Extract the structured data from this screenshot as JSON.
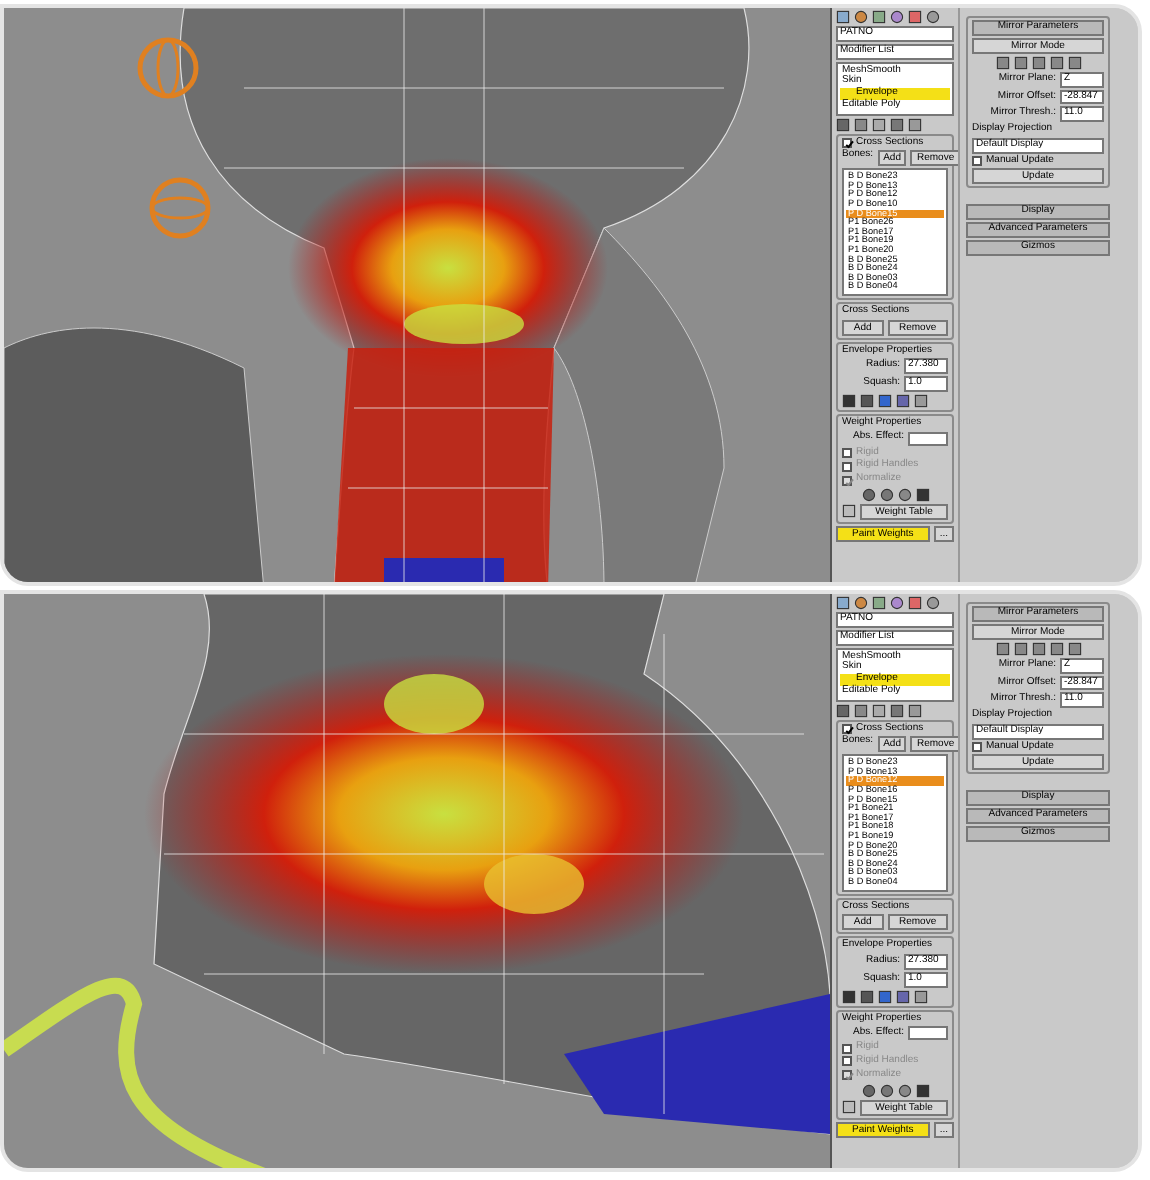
{
  "panels": [
    {
      "viewport": {
        "kind": "calf"
      },
      "modifier_name": "PATNO",
      "modifier_list": "Modifier List",
      "stack": [
        {
          "label": "MeshSmooth",
          "selected": false
        },
        {
          "label": "Skin",
          "selected": false
        },
        {
          "label": "Envelope",
          "selected": true
        },
        {
          "label": "Editable Poly",
          "selected": false
        }
      ],
      "cross_sections_check": {
        "label": "Cross Sections",
        "checked": true
      },
      "bones_label": "Bones:",
      "bone_buttons": [
        "Add",
        "Remove"
      ],
      "bones": [
        {
          "label": "B D Bone23",
          "selected": false
        },
        {
          "label": "P D Bone13",
          "selected": false
        },
        {
          "label": "P D Bone12",
          "selected": false
        },
        {
          "label": "P D Bone10",
          "selected": false
        },
        {
          "label": "P D Bone15",
          "selected": true
        },
        {
          "label": "P1 Bone26",
          "selected": false
        },
        {
          "label": "P1 Bone17",
          "selected": false
        },
        {
          "label": "P1 Bone19",
          "selected": false
        },
        {
          "label": "P1 Bone20",
          "selected": false
        },
        {
          "label": "B D Bone25",
          "selected": false
        },
        {
          "label": "B D Bone24",
          "selected": false
        },
        {
          "label": "B D Bone03",
          "selected": false
        },
        {
          "label": "B D Bone04",
          "selected": false
        }
      ],
      "cross_sections": {
        "title": "Cross Sections",
        "buttons": [
          "Add",
          "Remove"
        ]
      },
      "envelope": {
        "title": "Envelope Properties",
        "fields": [
          {
            "label": "Radius:",
            "value": "27.380"
          },
          {
            "label": "Squash:",
            "value": "1.0"
          }
        ]
      },
      "weight": {
        "title": "Weight Properties",
        "abs_effect": "Abs. Effect:",
        "checks": [
          {
            "label": "Rigid",
            "checked": false,
            "disabled": true
          },
          {
            "label": "Rigid Handles",
            "checked": false,
            "disabled": true
          },
          {
            "label": "Normalize",
            "checked": true,
            "disabled": true
          }
        ],
        "weight_table": "Weight Table",
        "paint_weights": "Paint Weights",
        "paint_options": "..."
      },
      "mirror": {
        "title": "Mirror Parameters",
        "mode": "Mirror Mode",
        "fields": [
          {
            "label": "Mirror Plane:",
            "value": "Z"
          },
          {
            "label": "Mirror Offset:",
            "value": "-28.847"
          },
          {
            "label": "Mirror Thresh.:",
            "value": "11.0"
          }
        ],
        "projection_label": "Display Projection",
        "projection": "Default Display",
        "manual_update": {
          "label": "Manual Update",
          "checked": false
        },
        "update": "Update"
      },
      "rollouts": [
        "Display",
        "Advanced Parameters",
        "Gizmos"
      ]
    },
    {
      "viewport": {
        "kind": "foot"
      },
      "modifier_name": "PATNO",
      "modifier_list": "Modifier List",
      "stack": [
        {
          "label": "MeshSmooth",
          "selected": false
        },
        {
          "label": "Skin",
          "selected": false
        },
        {
          "label": "Envelope",
          "selected": true
        },
        {
          "label": "Editable Poly",
          "selected": false
        }
      ],
      "cross_sections_check": {
        "label": "Cross Sections",
        "checked": true
      },
      "bones_label": "Bones:",
      "bone_buttons": [
        "Add",
        "Remove"
      ],
      "bones": [
        {
          "label": "B D Bone23",
          "selected": false
        },
        {
          "label": "P D Bone13",
          "selected": false
        },
        {
          "label": "P D Bone12",
          "selected": true
        },
        {
          "label": "P D Bone16",
          "selected": false
        },
        {
          "label": "P D Bone15",
          "selected": false
        },
        {
          "label": "P1 Bone21",
          "selected": false
        },
        {
          "label": "P1 Bone17",
          "selected": false
        },
        {
          "label": "P1 Bone18",
          "selected": false
        },
        {
          "label": "P1 Bone19",
          "selected": false
        },
        {
          "label": "P D Bone20",
          "selected": false
        },
        {
          "label": "B D Bone25",
          "selected": false
        },
        {
          "label": "B D Bone24",
          "selected": false
        },
        {
          "label": "B D Bone03",
          "selected": false
        },
        {
          "label": "B D Bone04",
          "selected": false
        }
      ],
      "cross_sections": {
        "title": "Cross Sections",
        "buttons": [
          "Add",
          "Remove"
        ]
      },
      "envelope": {
        "title": "Envelope Properties",
        "fields": [
          {
            "label": "Radius:",
            "value": "27.380"
          },
          {
            "label": "Squash:",
            "value": "1.0"
          }
        ]
      },
      "weight": {
        "title": "Weight Properties",
        "abs_effect": "Abs. Effect:",
        "checks": [
          {
            "label": "Rigid",
            "checked": false,
            "disabled": true
          },
          {
            "label": "Rigid Handles",
            "checked": false,
            "disabled": true
          },
          {
            "label": "Normalize",
            "checked": true,
            "disabled": true
          }
        ],
        "weight_table": "Weight Table",
        "paint_weights": "Paint Weights",
        "paint_options": "..."
      },
      "mirror": {
        "title": "Mirror Parameters",
        "mode": "Mirror Mode",
        "fields": [
          {
            "label": "Mirror Plane:",
            "value": "Z"
          },
          {
            "label": "Mirror Offset:",
            "value": "-28.847"
          },
          {
            "label": "Mirror Thresh.:",
            "value": "11.0"
          }
        ],
        "projection_label": "Display Projection",
        "projection": "Default Display",
        "manual_update": {
          "label": "Manual Update",
          "checked": false
        },
        "update": "Update"
      },
      "rollouts": [
        "Display",
        "Advanced Parameters",
        "Gizmos"
      ]
    }
  ]
}
